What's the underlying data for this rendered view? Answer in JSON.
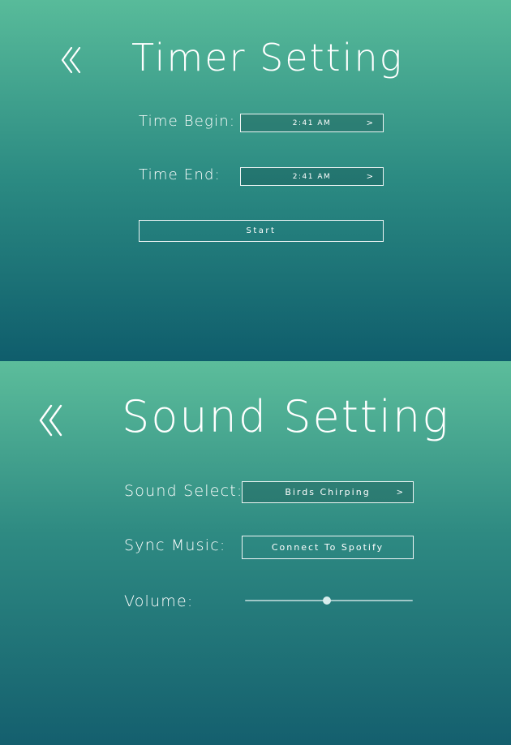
{
  "timer_setting": {
    "title": "Timer Setting",
    "time_begin": {
      "label": "Time Begin:",
      "value": "2:41 AM",
      "arrow": ">"
    },
    "time_end": {
      "label": "Time End:",
      "value": "2:41 AM",
      "arrow": ">"
    },
    "start_label": "Start",
    "back_icon": "double-chevron-left-icon"
  },
  "sound_setting": {
    "title": "Sound Setting",
    "sound_select": {
      "label": "Sound Select:",
      "value": "Birds Chirping",
      "arrow": ">"
    },
    "sync_music": {
      "label": "Sync Music:",
      "button_label": "Connect To Spotify"
    },
    "volume": {
      "label": "Volume:",
      "level": 0.49
    },
    "back_icon": "double-chevron-left-icon"
  },
  "colors": {
    "accent_text": "#ffffff",
    "gradient_top": "#58bb9a",
    "gradient_bottom": "#0f5d6c"
  }
}
